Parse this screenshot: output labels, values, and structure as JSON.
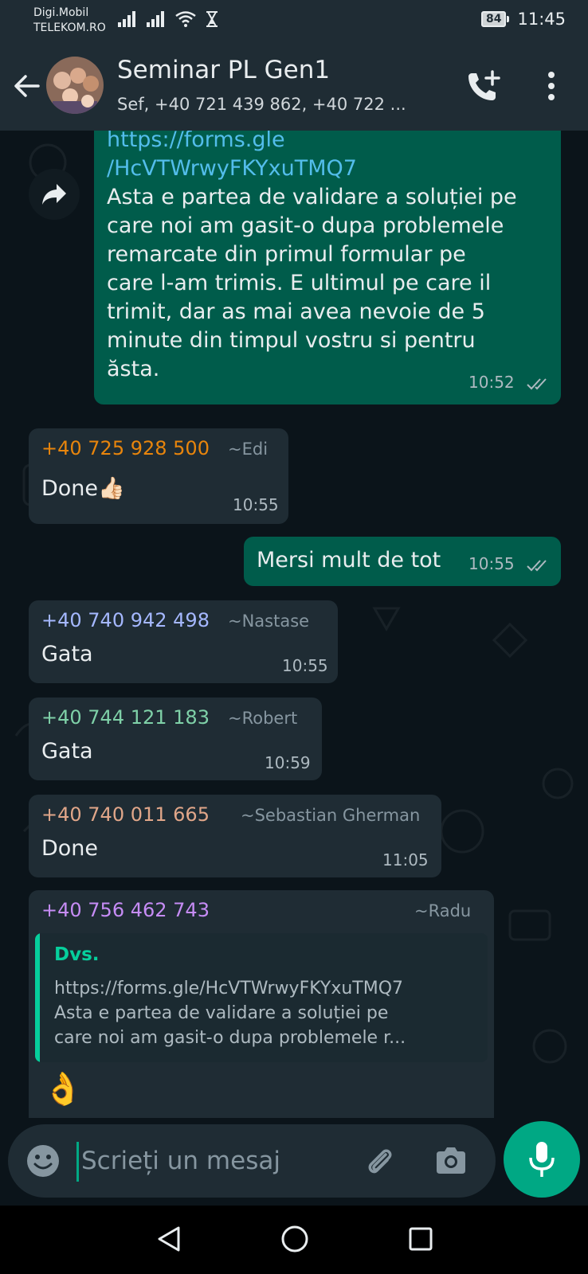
{
  "status_bar": {
    "carrier_line1": "Digi.Mobil",
    "carrier_line2": "TELEKOM.RO",
    "battery": "84",
    "time": "11:45"
  },
  "header": {
    "title": "Seminar PL Gen1",
    "subtitle": "Sef, +40 721 439 862, +40 722 ..."
  },
  "messages": {
    "m1": {
      "link_line1": "https://forms.gle",
      "link_line2": "/HcVTWrwyFKYxuTMQ7",
      "text_lines": [
        "Asta e partea de validare a soluției pe",
        "care noi am gasit-o dupa problemele",
        "remarcate din primul formular pe",
        "care l-am trimis. E ultimul pe care il",
        "trimit, dar as mai avea nevoie de 5",
        "minute din timpul vostru si pentru",
        "ăsta."
      ],
      "time": "10:52"
    },
    "m2": {
      "sender": "+40 725 928 500",
      "alias": "~Edi",
      "text": "Done👍🏻",
      "time": "10:55"
    },
    "m3": {
      "text": "Mersi mult de tot",
      "time": "10:55"
    },
    "m4": {
      "sender": "+40 740 942 498",
      "alias": "~Nastase",
      "text": "Gata",
      "time": "10:55"
    },
    "m5": {
      "sender": "+40 744 121 183",
      "alias": "~Robert",
      "text": "Gata",
      "time": "10:59"
    },
    "m6": {
      "sender": "+40 740 011 665",
      "alias": "~Sebastian Gherman",
      "text": "Done",
      "time": "11:05"
    },
    "m7": {
      "sender": "+40 756 462 743",
      "alias": "~Radu",
      "quote_author": "Dvs.",
      "quote_lines": [
        "https://forms.gle/HcVTWrwyFKYxuTMQ7",
        "Asta e partea de validare a soluției pe",
        "care noi am gasit-o dupa problemele r..."
      ],
      "text": "👌"
    }
  },
  "sender_colors": {
    "m2": "#e8850c",
    "m4": "#a5b8ff",
    "m5": "#7fd1a8",
    "m6": "#e0a689",
    "m7": "#c68cf5"
  },
  "input": {
    "placeholder": "Scrieți un mesaj"
  },
  "icons": {
    "back": "arrow-left-icon",
    "call": "add-call-icon",
    "menu": "more-vert-icon",
    "forward": "forward-icon",
    "emoji": "emoji-icon",
    "attach": "paperclip-icon",
    "camera": "camera-icon",
    "mic": "mic-icon"
  }
}
